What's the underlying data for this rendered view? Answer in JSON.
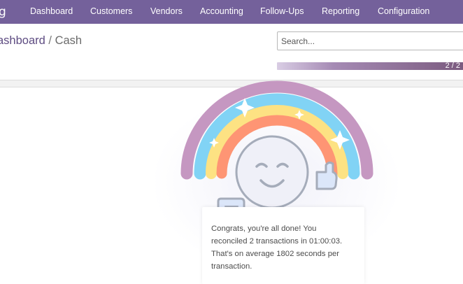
{
  "app": {
    "brand": "g"
  },
  "menu": [
    "Dashboard",
    "Customers",
    "Vendors",
    "Accounting",
    "Follow-Ups",
    "Reporting",
    "Configuration"
  ],
  "breadcrumb": {
    "parent": "ashboard",
    "separator": "/",
    "current": "Cash"
  },
  "search": {
    "placeholder": "Search..."
  },
  "progress": {
    "text": "2 / 2",
    "fraction": 1.0
  },
  "message": {
    "line1": "Congrats, you're all done! You",
    "line2": "reconciled 2 transactions in 01:00:03.",
    "line3": "That's on average 1802 seconds per",
    "line4": "transaction."
  },
  "colors": {
    "navbar": "#74619b",
    "brand_link": "#5e4c82",
    "rainbow": [
      "#c597c1",
      "#81d3f5",
      "#fde283",
      "#fe9574"
    ]
  },
  "icons": [
    "rainbow-illustration",
    "smiley-face-icon",
    "thumbs-up-icon",
    "sparkle-icon"
  ]
}
